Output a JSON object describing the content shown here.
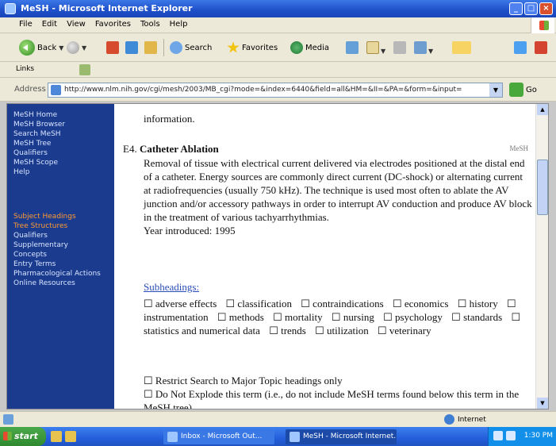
{
  "window": {
    "title": "MeSH - Microsoft Internet Explorer",
    "buttons": [
      "_",
      "□",
      "×"
    ]
  },
  "menu": [
    "File",
    "Edit",
    "View",
    "Favorites",
    "Tools",
    "Help"
  ],
  "toolbar": {
    "back_label": "Back",
    "search_label": "Search",
    "favorites_label": "Favorites",
    "media_label": "Media"
  },
  "links": {
    "label": "Links"
  },
  "address": {
    "label": "Address",
    "url": "http://www.nlm.nih.gov/cgi/mesh/2003/MB_cgi?mode=&index=6440&field=all&HM=&II=&PA=&form=&input=",
    "go_label": "Go"
  },
  "sidebar": {
    "top_links": [
      "MeSH Home",
      "MeSH Browser",
      "Search MeSH",
      "MeSH Tree",
      "Qualifiers",
      "MeSH Scope",
      "Help"
    ],
    "bottom_links": [
      "Subject Headings",
      "Tree Structures",
      "Qualifiers",
      "Supplementary",
      "Concepts",
      "Entry Terms",
      "Pharmacological Actions",
      "Online Resources"
    ]
  },
  "entry": {
    "intro_end": "information.",
    "code": "E4.",
    "heading": "Catheter Ablation",
    "tag": "MeSH",
    "definition": "Removal of tissue with electrical current delivered via electrodes positioned at the distal end of a catheter. Energy sources are commonly direct current (DC-shock) or alternating current at radiofrequencies (usually 750 kHz). The technique is used most often to ablate the AV junction and/or accessory pathways in order to interrupt AV conduction and produce AV block in the treatment of various tachyarrhythmias.",
    "year": "Year introduced: 1995",
    "subheadings_header": "Subheadings:",
    "subheadings": [
      "adverse effects",
      "classification",
      "contraindications",
      "economics",
      "history",
      "instrumentation",
      "methods",
      "mortality",
      "nursing",
      "psychology",
      "standards",
      "statistics and numerical data",
      "trends",
      "utilization",
      "veterinary"
    ],
    "note1": "Restrict Search to Major Topic headings only",
    "note2": "Do Not Explode this term (i.e., do not include MeSH terms found below this term in the MeSH tree)."
  },
  "status": {
    "zone": "Internet"
  },
  "taskbar": {
    "start": "start",
    "tasks": [
      "Inbox - Microsoft Out...",
      "MeSH - Microsoft Internet..."
    ],
    "clock": "1:30 PM"
  }
}
